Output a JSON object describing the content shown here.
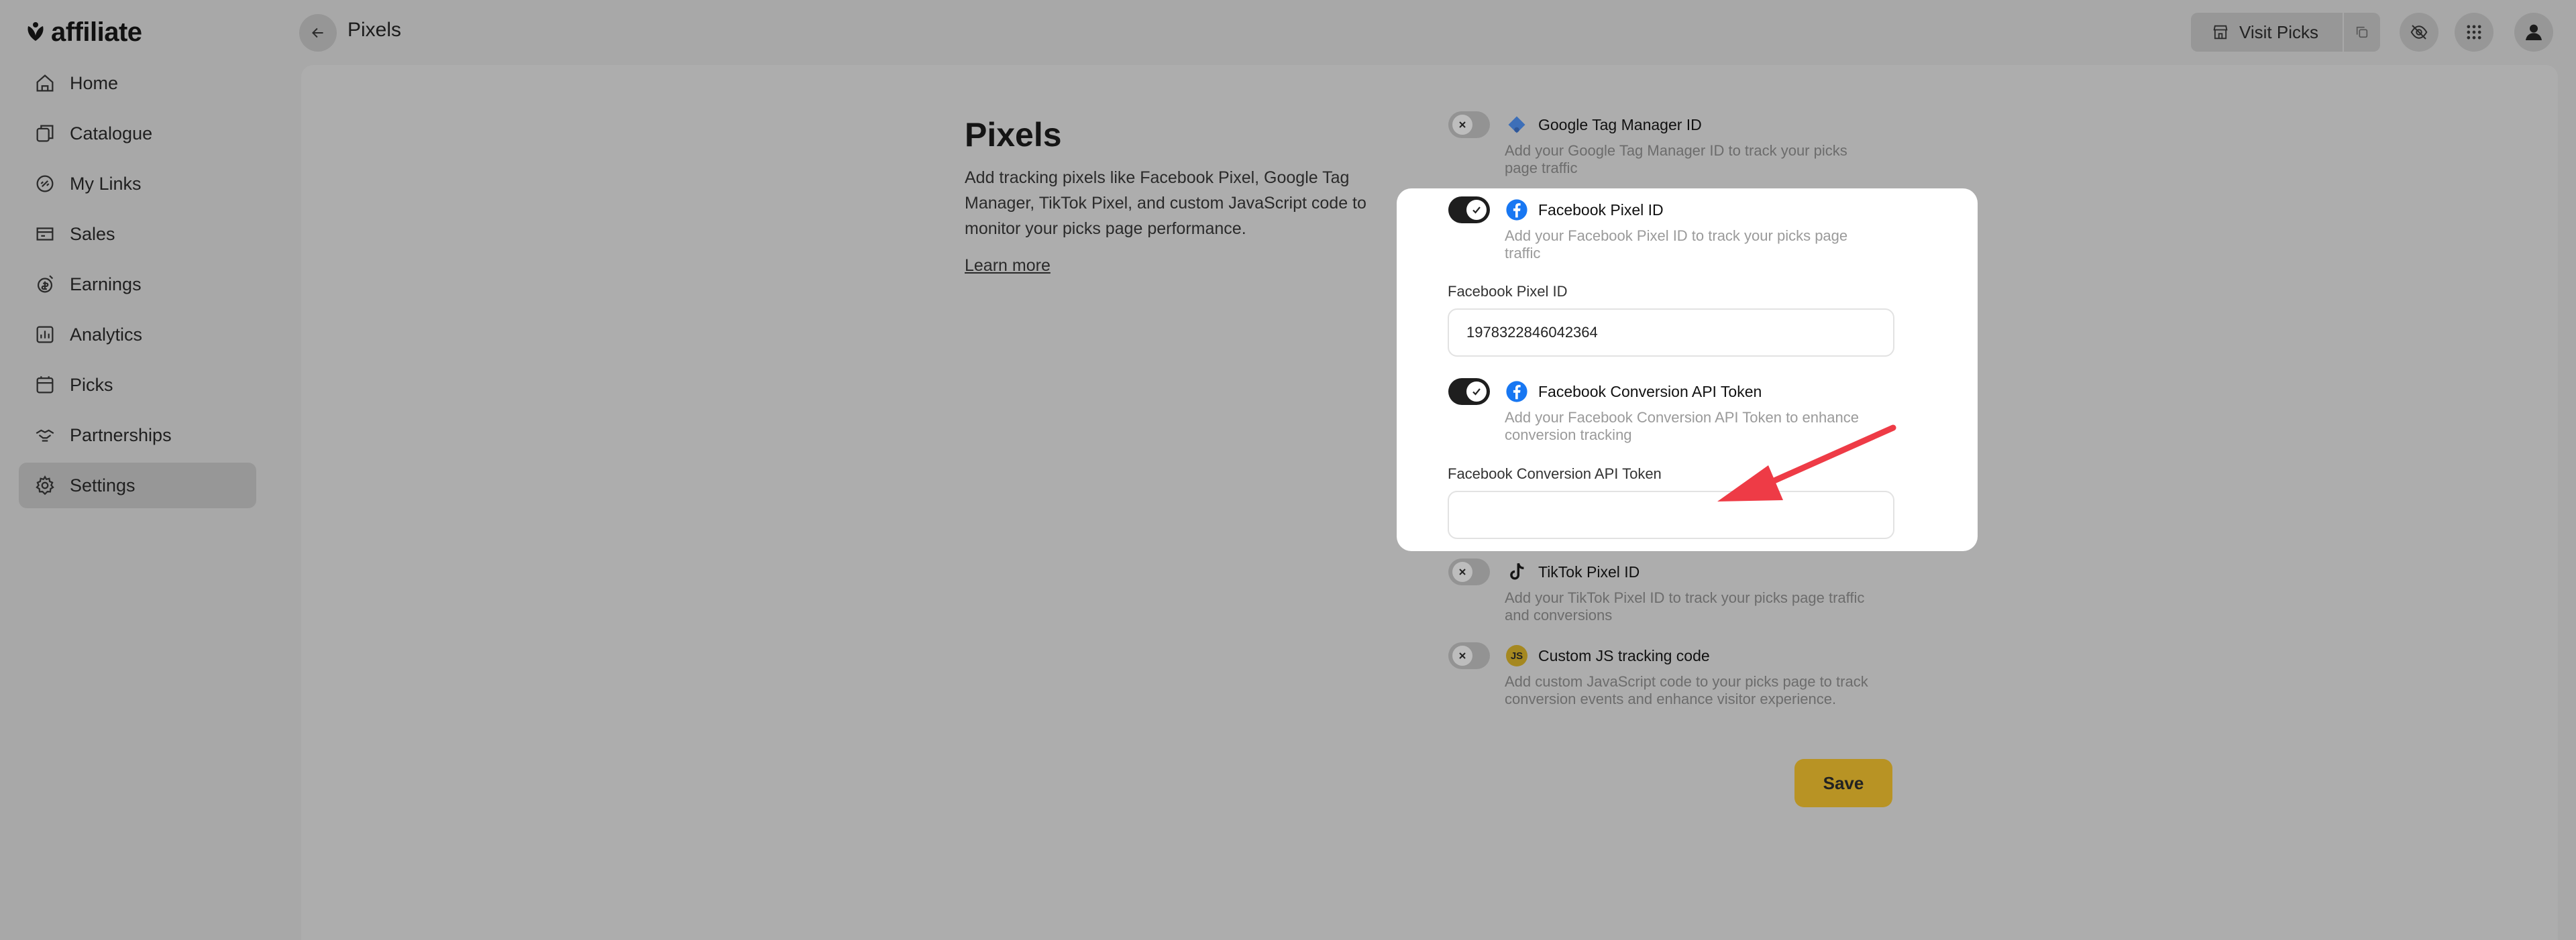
{
  "app": {
    "logo_text": "affiliate"
  },
  "sidebar": {
    "items": [
      {
        "label": "Home",
        "icon": "home-icon"
      },
      {
        "label": "Catalogue",
        "icon": "catalogue-icon"
      },
      {
        "label": "My Links",
        "icon": "link-icon"
      },
      {
        "label": "Sales",
        "icon": "sales-icon"
      },
      {
        "label": "Earnings",
        "icon": "earnings-icon"
      },
      {
        "label": "Analytics",
        "icon": "analytics-icon"
      },
      {
        "label": "Picks",
        "icon": "picks-icon"
      },
      {
        "label": "Partnerships",
        "icon": "partnerships-icon"
      },
      {
        "label": "Settings",
        "icon": "gear-icon",
        "active": true
      }
    ]
  },
  "header": {
    "title": "Pixels",
    "visit_label": "Visit Picks"
  },
  "intro": {
    "title": "Pixels",
    "description": "Add tracking pixels like Facebook Pixel, Google Tag Manager, TikTok Pixel, and custom JavaScript code to monitor your picks page performance.",
    "learn_more": "Learn more"
  },
  "pixels": {
    "gtm": {
      "title": "Google Tag Manager ID",
      "description": "Add your Google Tag Manager ID to track your picks page traffic",
      "enabled": false
    },
    "fb_pixel": {
      "title": "Facebook Pixel ID",
      "description": "Add your Facebook Pixel ID to track your picks page traffic",
      "enabled": true,
      "field_label": "Facebook Pixel ID",
      "field_value": "1978322846042364"
    },
    "fb_capi": {
      "title": "Facebook Conversion API Token",
      "description": "Add your Facebook Conversion API Token to enhance conversion tracking",
      "enabled": true,
      "field_label": "Facebook Conversion API Token",
      "field_value": ""
    },
    "tiktok": {
      "title": "TikTok Pixel ID",
      "description": "Add your TikTok Pixel ID to track your picks page traffic and conversions",
      "enabled": false
    },
    "custom_js": {
      "title": "Custom JS tracking code",
      "description": "Add custom JavaScript code to your picks page to track conversion events and enhance visitor experience.",
      "enabled": false,
      "badge": "JS"
    }
  },
  "actions": {
    "save_label": "Save"
  },
  "colors": {
    "accent": "#b89324",
    "arrow": "#ee3b46",
    "facebook": "#1877f2"
  }
}
